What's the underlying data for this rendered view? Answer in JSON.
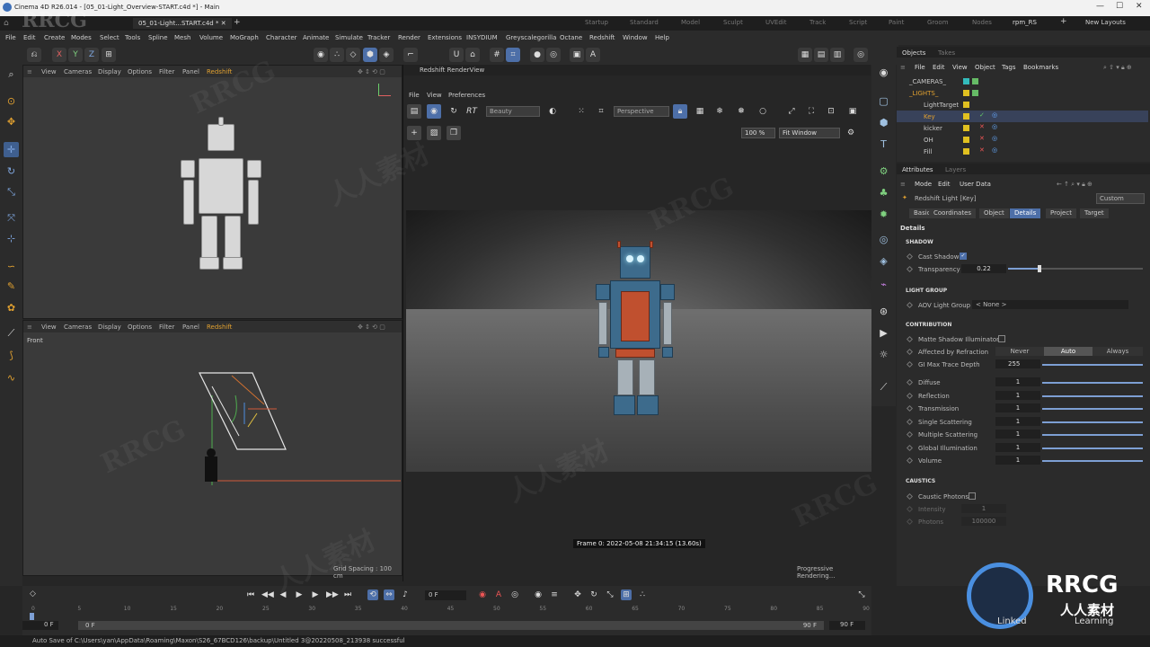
{
  "app": {
    "title": "Cinema 4D R26.014 - [05_01-Light_Overview-START.c4d *] - Main"
  },
  "doc_tab": "05_01-Light...START.c4d *",
  "layouts": [
    "Startup",
    "Standard",
    "Model",
    "Sculpt",
    "UVEdit",
    "Track",
    "Script",
    "Paint",
    "Groom",
    "Nodes",
    "rpm_RS"
  ],
  "layouts_active": "rpm_RS",
  "new_layouts": "New Layouts",
  "menu": [
    "File",
    "Edit",
    "Create",
    "Modes",
    "Select",
    "Tools",
    "Spline",
    "Mesh",
    "Volume",
    "MoGraph",
    "Character",
    "Animate",
    "Simulate",
    "Tracker",
    "Render",
    "Extensions",
    "INSYDIUM",
    "Greyscalegorilla",
    "Octane",
    "Redshift",
    "Window",
    "Help"
  ],
  "axes": [
    "X",
    "Y",
    "Z"
  ],
  "viewport": {
    "menu": [
      "View",
      "Cameras",
      "Display",
      "Options",
      "Filter",
      "Panel",
      "Redshift"
    ],
    "front_label": "Front",
    "grid": "Grid Spacing : 100 cm"
  },
  "renderview": {
    "title": "Redshift RenderView",
    "menu": [
      "File",
      "View",
      "Preferences"
    ],
    "beauty": "Beauty",
    "camera": "Perspective",
    "zoom": "100 %",
    "fit": "Fit Window",
    "frame_info": "Frame  0:  2022-05-08  21:34:15  (13.60s)",
    "progress": "Progressive Rendering..."
  },
  "objects": {
    "tabs": [
      "Objects",
      "Takes"
    ],
    "menu": [
      "File",
      "Edit",
      "View",
      "Object",
      "Tags",
      "Bookmarks"
    ],
    "items": [
      "_CAMERAS_",
      "_LIGHTS_",
      "LightTarget",
      "Key",
      "kicker",
      "OH",
      "Fill"
    ]
  },
  "attributes": {
    "tabs": [
      "Attributes",
      "Layers"
    ],
    "menu": [
      "Mode",
      "Edit",
      "User Data"
    ],
    "object": "Redshift Light [Key]",
    "preset": "Custom",
    "subtabs": [
      "Basic",
      "Coordinates",
      "Object",
      "Details",
      "Project",
      "Target"
    ],
    "heading": "Details",
    "shadow": {
      "title": "SHADOW",
      "cast": "Cast Shadow",
      "transparency_label": "Transparency",
      "transparency": "0.22"
    },
    "light_group": {
      "title": "LIGHT GROUP",
      "aov_label": "AOV Light Group",
      "aov_value": "< None >"
    },
    "contribution": {
      "title": "CONTRIBUTION",
      "matte": "Matte Shadow Illuminator",
      "affected": "Affected by Refraction",
      "refr_opts": [
        "Never",
        "Auto",
        "Always"
      ],
      "gi_label": "GI Max Trace Depth",
      "gi": "255",
      "rows": [
        {
          "label": "Diffuse",
          "value": "1"
        },
        {
          "label": "Reflection",
          "value": "1"
        },
        {
          "label": "Transmission",
          "value": "1"
        },
        {
          "label": "Single Scattering",
          "value": "1"
        },
        {
          "label": "Multiple Scattering",
          "value": "1"
        },
        {
          "label": "Global Illumination",
          "value": "1"
        },
        {
          "label": "Volume",
          "value": "1"
        }
      ]
    },
    "caustics": {
      "title": "CAUSTICS",
      "photons": "Caustic Photons",
      "intensity_label": "Intensity",
      "intensity": "1",
      "photons_label": "Photons",
      "photons_val": "100000"
    }
  },
  "timeline": {
    "ticks": [
      "0",
      "5",
      "10",
      "15",
      "20",
      "25",
      "30",
      "35",
      "40",
      "45",
      "50",
      "55",
      "60",
      "65",
      "70",
      "75",
      "80",
      "85",
      "90"
    ],
    "start": "0 F",
    "start2": "0 F",
    "current": "0 F",
    "end": "90 F",
    "end2": "90 F"
  },
  "status": "Auto Save of C:\\Users\\yan\\AppData\\Roaming\\Maxon\\S26_67BCD126\\backup\\Untitled 3@20220508_213938 successful",
  "watermarks": {
    "rrcg": "RRCG",
    "cn": "人人素材",
    "brand": "RRCG",
    "brand_cn": "人人素材",
    "linked": "Linked",
    "learning": "Learning"
  },
  "colors": {
    "accent": "#4d6fa8",
    "robot_blue": "#3d6b8c",
    "robot_red": "#c0502f"
  }
}
